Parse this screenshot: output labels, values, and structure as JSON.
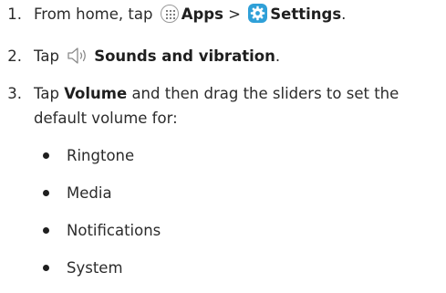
{
  "steps": [
    {
      "number": "1.",
      "prefix": "From home, tap",
      "apps_label": "Apps",
      "separator": ">",
      "settings_label": "Settings",
      "suffix": "."
    },
    {
      "number": "2.",
      "prefix": "Tap",
      "sounds_label": "Sounds and vibration",
      "suffix": "."
    },
    {
      "number": "3.",
      "prefix": "Tap",
      "volume_label": "Volume",
      "line1_rest": "and then drag the sliders to set the",
      "line2": "default volume for:"
    }
  ],
  "bullets": [
    "Ringtone",
    "Media",
    "Notifications",
    "System"
  ],
  "icons": {
    "apps": "apps-icon",
    "settings": "gear-icon",
    "sounds": "speaker-icon"
  },
  "colors": {
    "text": "#2b2b2b",
    "settings_icon_bg": "#2fa0d8"
  }
}
